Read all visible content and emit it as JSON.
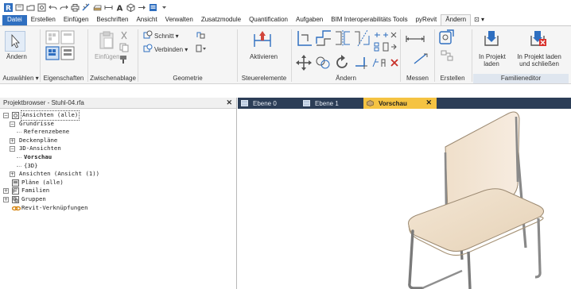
{
  "qat": {
    "icons": [
      "app-menu-icon",
      "open-icon",
      "save-icon",
      "sync-icon",
      "undo-icon",
      "redo-icon",
      "print-icon",
      "measure-icon",
      "wall-icon",
      "dimension-icon",
      "text-icon",
      "view-3d-icon",
      "section-icon",
      "switch-windows-icon",
      "customize-icon"
    ]
  },
  "ribbon_tabs": [
    {
      "name": "tab-datei",
      "label": "Datei",
      "kind": "file"
    },
    {
      "name": "tab-erstellen",
      "label": "Erstellen"
    },
    {
      "name": "tab-einfuegen",
      "label": "Einfügen"
    },
    {
      "name": "tab-beschriften",
      "label": "Beschriften"
    },
    {
      "name": "tab-ansicht",
      "label": "Ansicht"
    },
    {
      "name": "tab-verwalten",
      "label": "Verwalten"
    },
    {
      "name": "tab-zusatzmodule",
      "label": "Zusatzmodule"
    },
    {
      "name": "tab-quantification",
      "label": "Quantification"
    },
    {
      "name": "tab-aufgaben",
      "label": "Aufgaben"
    },
    {
      "name": "tab-bim-interoperability",
      "label": "BIM Interoperabilitäts Tools"
    },
    {
      "name": "tab-pyrevit",
      "label": "pyRevit"
    },
    {
      "name": "tab-aendern",
      "label": "Ändern",
      "kind": "active"
    },
    {
      "name": "tab-more",
      "label": "⊡ ▾",
      "kind": "more"
    }
  ],
  "ribbon": {
    "aendern_button": "Ändern",
    "auswaehlen": "Auswählen ▾",
    "eigenschaften": "Eigenschaften",
    "einfuegen_button": "Einfügen",
    "zwischenablage": "Zwischenablage",
    "schnitt": "Schnitt ▾",
    "verbinden": "Verbinden ▾",
    "geometrie": "Geometrie",
    "aktivieren": "Aktivieren",
    "steuerelemente": "Steuerelemente",
    "aendern_panel": "Ändern",
    "messen": "Messen",
    "erstellen": "Erstellen",
    "in_projekt_laden_1": "In Projekt",
    "in_projekt_laden_2": "laden",
    "in_projekt_schliessen_1": "In Projekt laden",
    "in_projekt_schliessen_2": "und schließen",
    "familieneditor": "Familieneditor"
  },
  "project_browser": {
    "title": "Projektbrowser - Stuhl-04.rfa",
    "close": "✕",
    "tree": [
      {
        "name": "tree-ansichten-alle",
        "label": "Ansichten (alle)",
        "level": 0,
        "exp": "−",
        "icon": "views-icon",
        "selected": true
      },
      {
        "name": "tree-grundrisse",
        "label": "Grundrisse",
        "level": 1,
        "exp": "−"
      },
      {
        "name": "tree-referenzebene",
        "label": "Referenzebene",
        "level": 2
      },
      {
        "name": "tree-deckenplaene",
        "label": "Deckenpläne",
        "level": 1,
        "exp": "+"
      },
      {
        "name": "tree-3d-ansichten",
        "label": "3D-Ansichten",
        "level": 1,
        "exp": "−"
      },
      {
        "name": "tree-vorschau",
        "label": "Vorschau",
        "level": 2,
        "bold": true
      },
      {
        "name": "tree-3d",
        "label": "{3D}",
        "level": 2
      },
      {
        "name": "tree-ansichten-ansicht",
        "label": "Ansichten (Ansicht (1))",
        "level": 1,
        "exp": "+"
      },
      {
        "name": "tree-plaene-alle",
        "label": "Pläne (alle)",
        "level": 0,
        "icon": "sheets-icon"
      },
      {
        "name": "tree-familien",
        "label": "Familien",
        "level": 0,
        "exp": "+",
        "icon": "families-icon"
      },
      {
        "name": "tree-gruppen",
        "label": "Gruppen",
        "level": 0,
        "exp": "+",
        "icon": "groups-icon"
      },
      {
        "name": "tree-revit-verknuepfungen",
        "label": "Revit-Verknüpfungen",
        "level": 0,
        "icon": "links-icon"
      }
    ]
  },
  "doc_tabs": [
    {
      "name": "doc-tab-ebene-0",
      "label": "Ebene 0",
      "icon": "floor-plan-icon",
      "active": false
    },
    {
      "name": "doc-tab-ebene-1",
      "label": "Ebene 1",
      "icon": "floor-plan-icon",
      "active": false
    },
    {
      "name": "doc-tab-vorschau",
      "label": "Vorschau",
      "icon": "view-3d-icon",
      "active": true,
      "close": "✕"
    }
  ]
}
